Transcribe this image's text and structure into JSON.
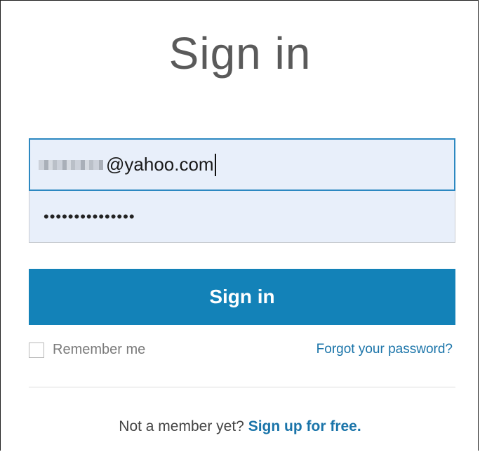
{
  "page": {
    "title": "Sign in"
  },
  "form": {
    "email_value": "@yahoo.com",
    "password_value": "•••••••••••••••",
    "submit_label": "Sign in",
    "remember_label": "Remember me",
    "remember_checked": false,
    "forgot_label": "Forgot your password?"
  },
  "footer": {
    "prompt": "Not a member yet?",
    "signup_label": "Sign up for free."
  },
  "colors": {
    "accent": "#1382b8",
    "link": "#1a74a9",
    "field_bg": "#e8effa",
    "focus_border": "#2c88c1"
  }
}
